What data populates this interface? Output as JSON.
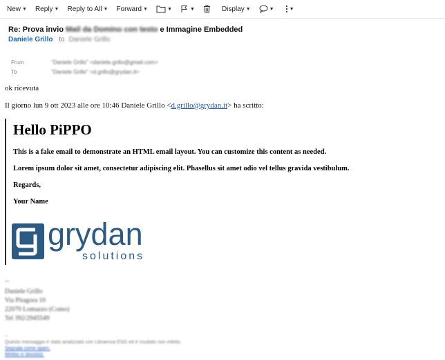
{
  "toolbar": {
    "new_label": "New",
    "reply_label": "Reply",
    "reply_all_label": "Reply to All",
    "forward_label": "Forward",
    "display_label": "Display",
    "icons": [
      "folder-icon",
      "flag-icon",
      "trash-icon",
      "chat-icon",
      "more-icon"
    ]
  },
  "message": {
    "subject_prefix": "Re: Prova invio",
    "subject_blurred": "Mail da Domino con testo",
    "subject_suffix": "e Immagine Embedded",
    "sender_name": "Daniele Grillo",
    "to_word": "to",
    "to_name": "Daniele Grillo",
    "from_label": "From",
    "from_value": "\"Daniele Grillo\" <daniele.grillo@gmail.com>",
    "to_label": "To",
    "to_value": "\"Daniele Grillo\" <d.grillo@grydan.it>"
  },
  "body": {
    "reply_text": "ok ricevuta",
    "quote_intro_before": "Il giorno lun 9 ott 2023 alle ore 10:46 Daniele Grillo <",
    "quote_intro_email": "d.grillo@grydan.it",
    "quote_intro_after": "> ha scritto:",
    "quoted": {
      "heading": "Hello PiPPO",
      "para1": "This is a fake email to demonstrate an HTML email layout. You can customize this content as needed.",
      "para2": "Lorem ipsum dolor sit amet, consectetur adipiscing elit. Phasellus sit amet odio vel tellus gravida vestibulum.",
      "regards": "Regards,",
      "your_name": "Your Name",
      "logo_word": "grydan",
      "logo_sub": "solutions"
    }
  },
  "signature": {
    "separator": "--",
    "name": "Daniele Grillo",
    "street": "Via Pitagora 10",
    "city": "22070 Lomazzo (Como)",
    "phone": "Tel 392/2945549"
  },
  "footer": {
    "separator": "--",
    "scan_note": "Questo messaggio è stato analizzato con Libraesva ESG ed è risultato non infetto.",
    "spam_link": "Segnala come spam.",
    "blocklist_link": "Mettilo in blocklist."
  },
  "colors": {
    "link": "#1a56c4",
    "sender": "#1a66b3",
    "logo": "#2b5a84"
  }
}
